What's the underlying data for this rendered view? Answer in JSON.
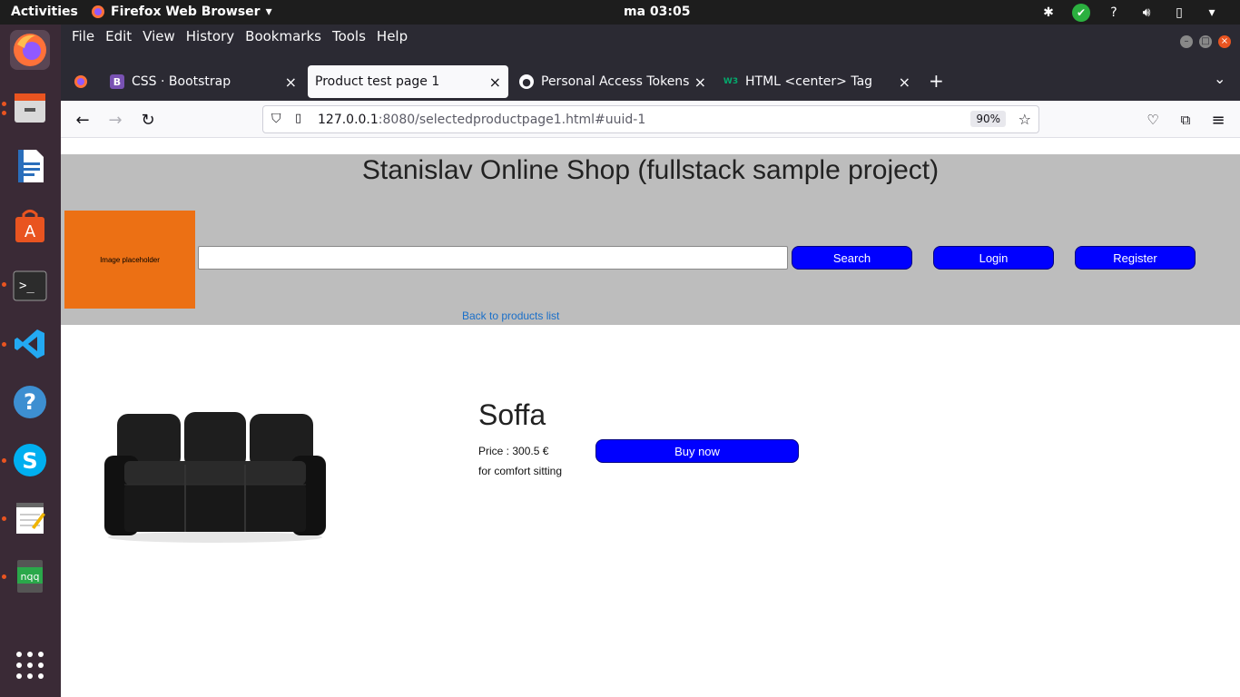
{
  "topbar": {
    "activities": "Activities",
    "app_name": "Firefox Web Browser",
    "clock": "ma 03:05"
  },
  "browser": {
    "menu": [
      "File",
      "Edit",
      "View",
      "History",
      "Bookmarks",
      "Tools",
      "Help"
    ],
    "tabs": [
      {
        "label": "CSS · Bootstrap",
        "icon": "bootstrap-icon"
      },
      {
        "label": "Product test page 1",
        "icon": ""
      },
      {
        "label": "Personal Access Tokens (",
        "icon": "github-icon"
      },
      {
        "label": "HTML <center> Tag",
        "icon": "w3schools-icon"
      }
    ],
    "url_host": "127.0.0.1",
    "url_path": ":8080/selectedproductpage1.html#uuid-1",
    "zoom": "90%"
  },
  "page": {
    "site_title": "Stanislav Online Shop (fullstack sample project)",
    "logo_text": "Image placeholder",
    "search_value": "",
    "search_button": "Search",
    "login_button": "Login",
    "register_button": "Register",
    "back_link": "Back to products list",
    "product": {
      "name": "Soffa",
      "price": "Price : 300.5 €",
      "description": "for comfort sitting",
      "buy_button": "Buy now"
    }
  },
  "colors": {
    "header_bg": "#bdbdbd",
    "logo_bg": "#ec7014",
    "button_bg": "#0000ff",
    "link": "#1a6fc9"
  }
}
